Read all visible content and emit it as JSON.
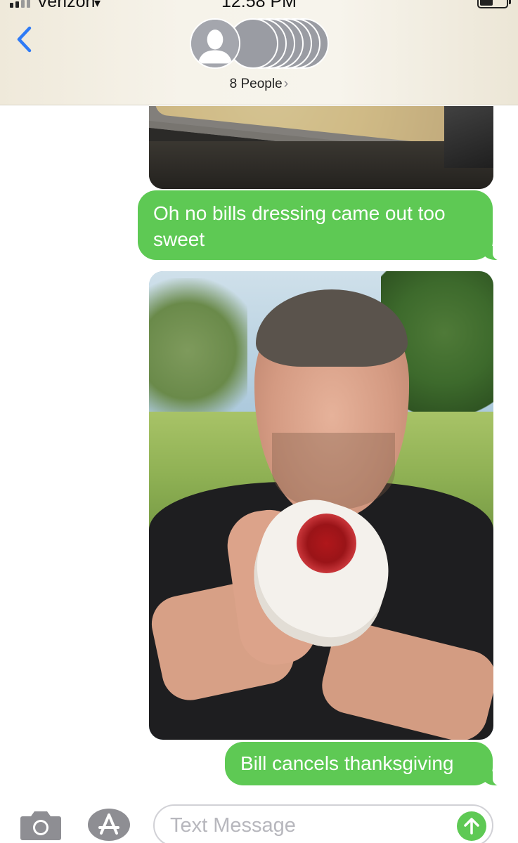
{
  "status_bar": {
    "carrier": "Verizon",
    "time": "12:58 PM"
  },
  "header": {
    "group_name": "8 People",
    "chevron": "›",
    "avatar_count": 8
  },
  "messages": [
    {
      "type": "image",
      "icon": "photo-dressing-tray"
    },
    {
      "type": "text",
      "text": "Oh no bills dressing came out too sweet"
    },
    {
      "type": "image",
      "icon": "photo-man-bandaged-hand"
    },
    {
      "type": "text",
      "text": "Bill cancels thanksgiving"
    }
  ],
  "input": {
    "placeholder": "Text Message"
  },
  "colors": {
    "bubble_green": "#5ec954",
    "ios_blue": "#2f7bf6",
    "header_bg": "#f6f3ea"
  }
}
